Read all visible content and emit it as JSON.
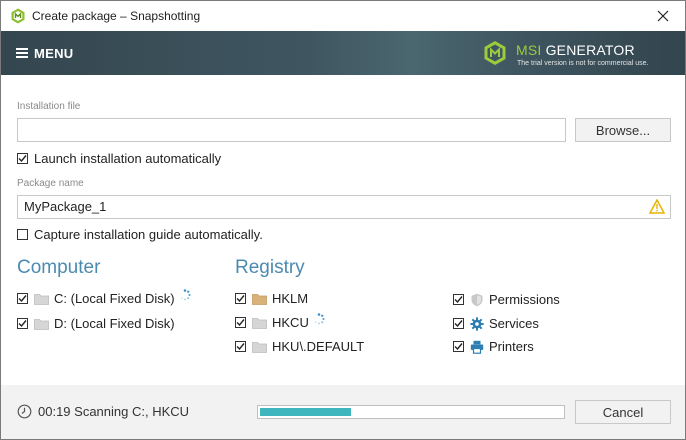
{
  "window": {
    "title": "Create package – Snapshotting"
  },
  "header": {
    "menu_label": "MENU",
    "brand_prefix": "MSI",
    "brand_rest": " GENERATOR",
    "brand_subtitle": "The trial version is not for commercial use."
  },
  "installation": {
    "label": "Installation file",
    "value": "",
    "browse_label": "Browse...",
    "launch_label": "Launch installation automatically",
    "launch_checked": true
  },
  "package": {
    "label": "Package name",
    "value": "MyPackage_1",
    "capture_label": "Capture installation guide automatically.",
    "capture_checked": false
  },
  "computer": {
    "title": "Computer",
    "items": [
      {
        "label": "C: (Local Fixed Disk)",
        "checked": true,
        "busy": true
      },
      {
        "label": "D: (Local Fixed Disk)",
        "checked": true,
        "busy": false
      }
    ]
  },
  "registry": {
    "title": "Registry",
    "items": [
      {
        "label": "HKLM",
        "checked": true,
        "busy": false
      },
      {
        "label": "HKCU",
        "checked": true,
        "busy": true
      },
      {
        "label": "HKU\\.DEFAULT",
        "checked": true,
        "busy": false
      }
    ]
  },
  "other": {
    "items": [
      {
        "label": "Permissions",
        "checked": true,
        "icon": "shield-icon"
      },
      {
        "label": "Services",
        "checked": true,
        "icon": "gear-icon"
      },
      {
        "label": "Printers",
        "checked": true,
        "icon": "printer-icon"
      }
    ]
  },
  "footer": {
    "status_text": "00:19 Scanning C:, HKCU",
    "progress": 0.3,
    "cancel_label": "Cancel"
  },
  "colors": {
    "accent": "#4b8bb0",
    "progress": "#3fb5bd",
    "brand_green": "#9ccb3b",
    "header_bg": "#3f5660"
  }
}
